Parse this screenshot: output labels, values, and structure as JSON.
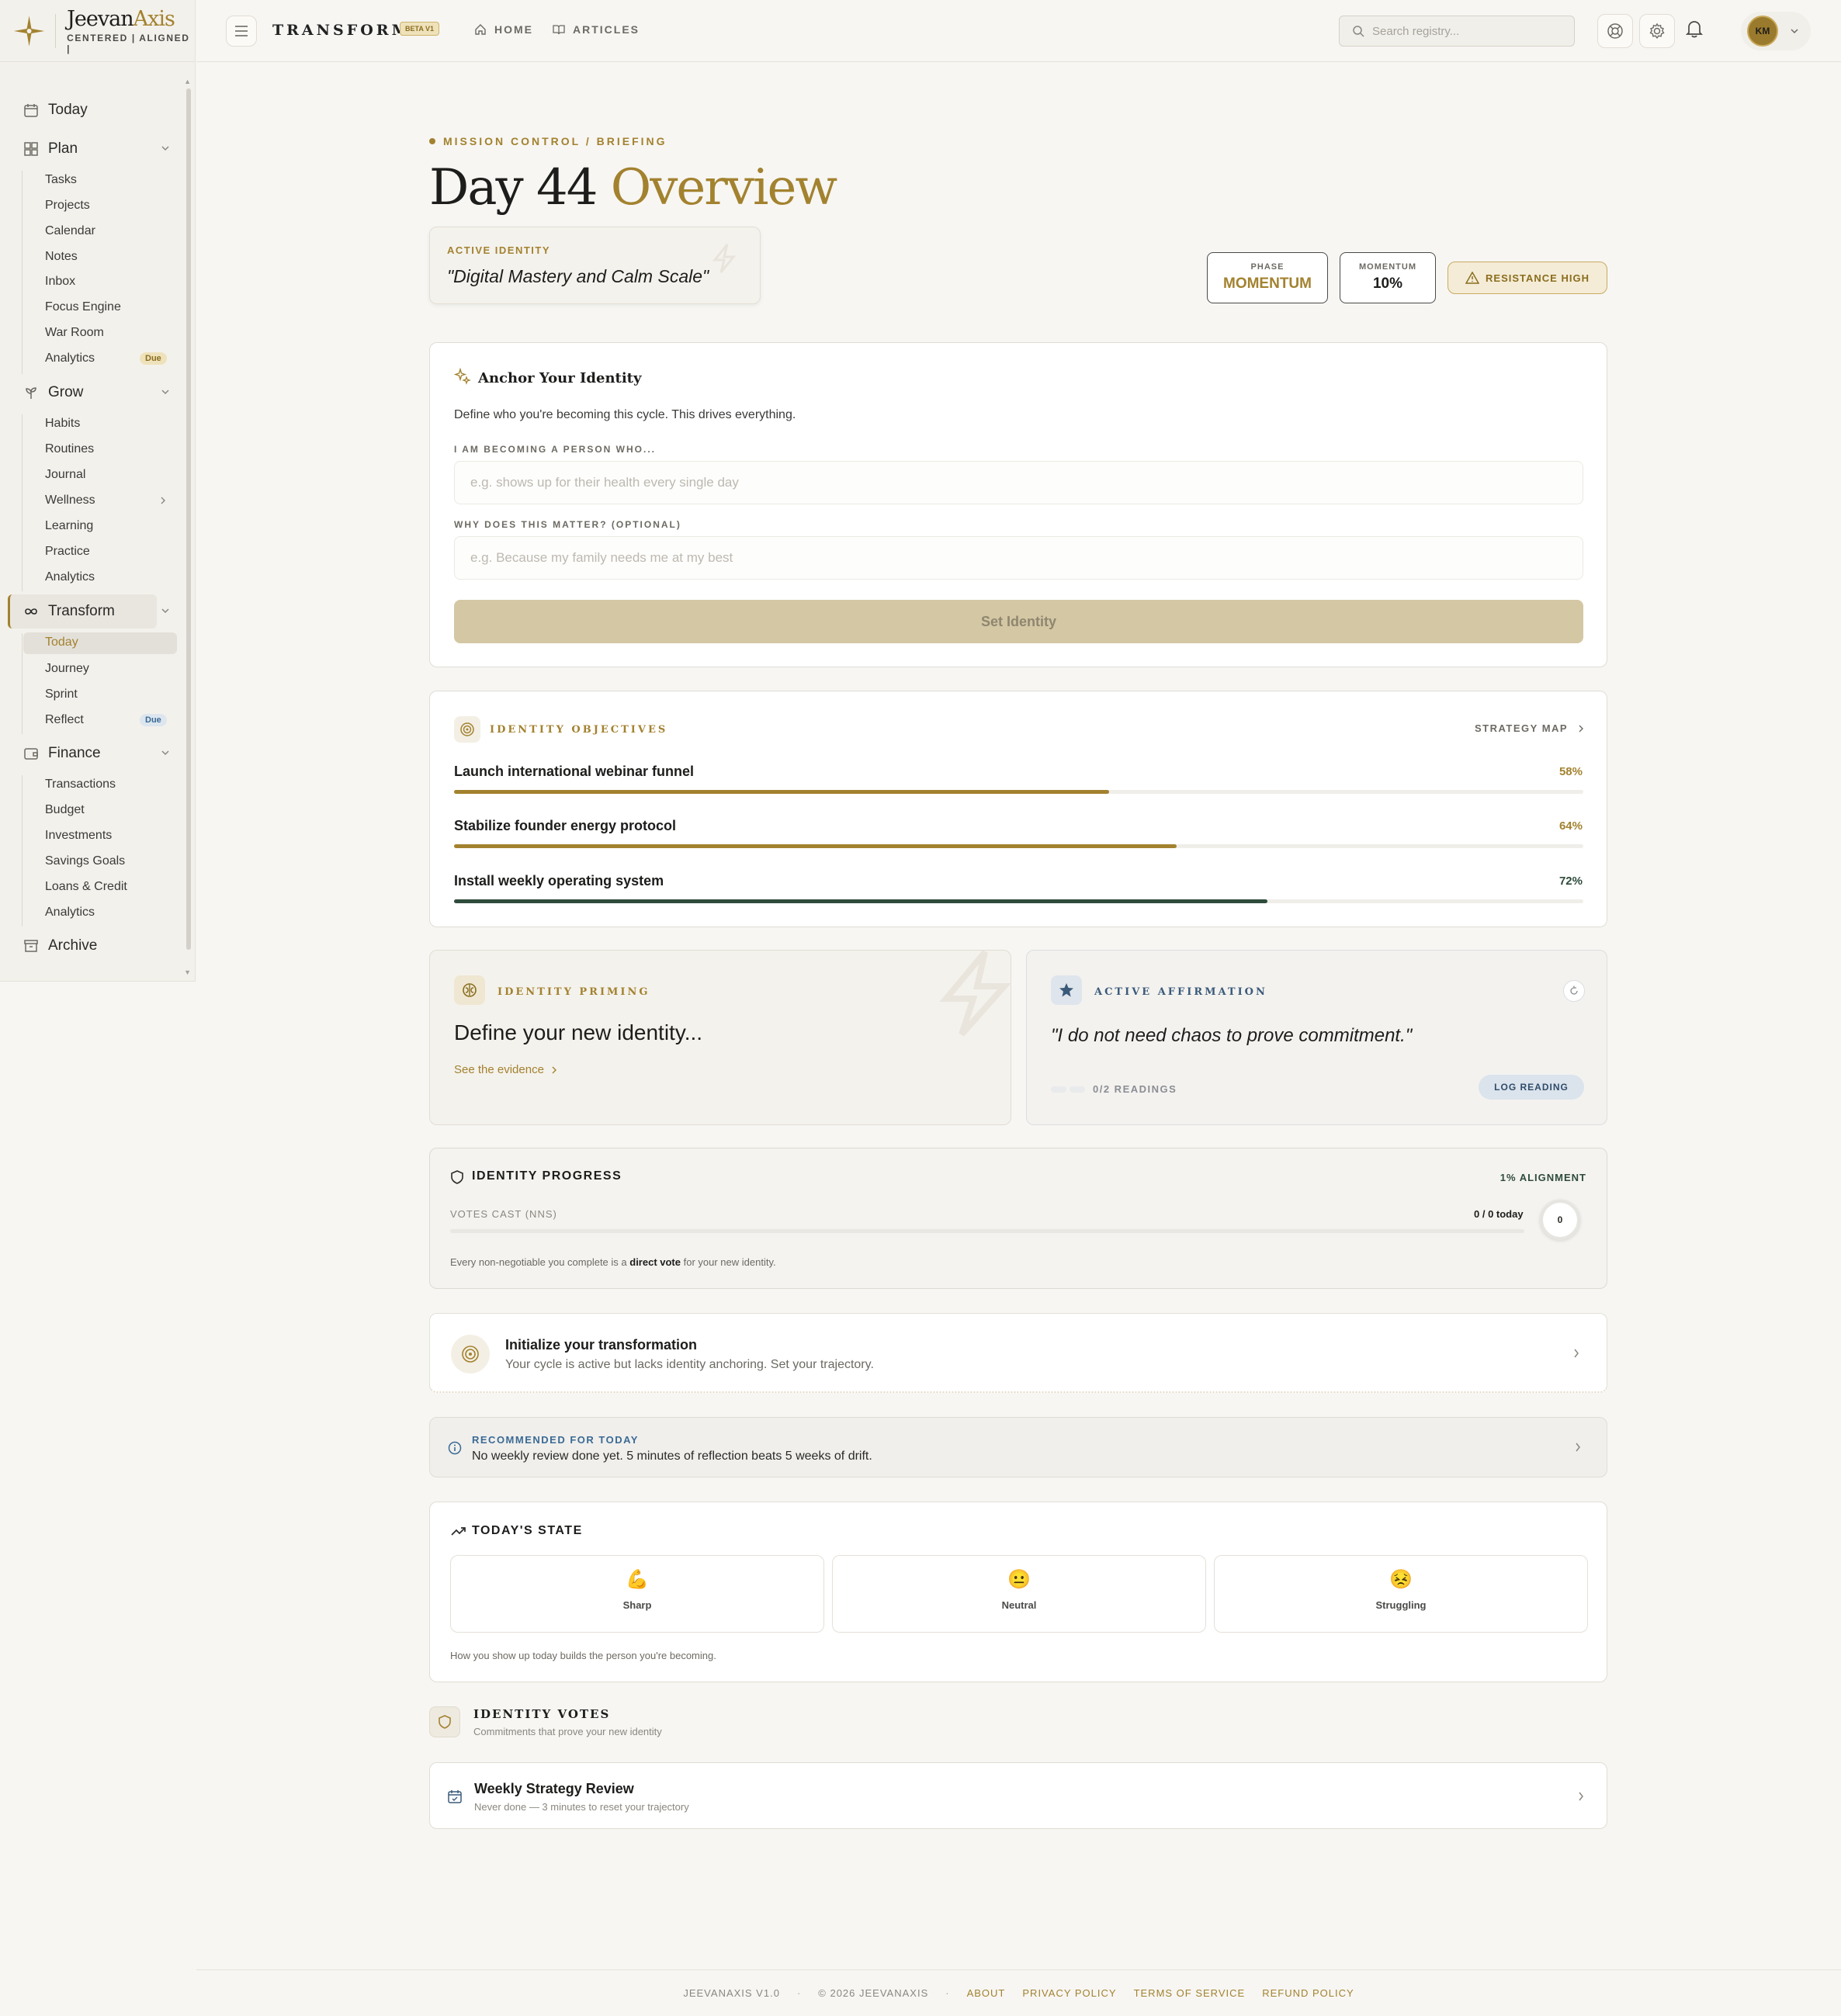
{
  "brand": {
    "name_a": "Jeevan",
    "name_b": "Axis",
    "tagline": "CENTERED | ALIGNED |"
  },
  "sidebar": {
    "today": "Today",
    "plan": {
      "label": "Plan",
      "items": [
        "Tasks",
        "Projects",
        "Calendar",
        "Notes",
        "Inbox",
        "Focus Engine",
        "War Room",
        "Analytics"
      ],
      "badge": "Due"
    },
    "grow": {
      "label": "Grow",
      "items": [
        "Habits",
        "Routines",
        "Journal",
        "Wellness",
        "Learning",
        "Practice",
        "Analytics"
      ]
    },
    "transform": {
      "label": "Transform",
      "items": [
        "Today",
        "Journey",
        "Sprint",
        "Reflect"
      ],
      "badge": "Due"
    },
    "finance": {
      "label": "Finance",
      "items": [
        "Transactions",
        "Budget",
        "Investments",
        "Savings Goals",
        "Loans & Credit",
        "Analytics"
      ]
    },
    "archive": "Archive"
  },
  "header": {
    "title": "TRANSFORM",
    "beta": "BETA V1",
    "nav": [
      "HOME",
      "ARTICLES"
    ],
    "search_placeholder": "Search registry...",
    "avatar": "KM"
  },
  "overview": {
    "breadcrumb": "MISSION CONTROL / BRIEFING",
    "title_a": "Day 44",
    "title_b": "Overview",
    "identity_label": "ACTIVE IDENTITY",
    "identity_value": "\"Digital Mastery and Calm Scale\"",
    "phase_label": "PHASE",
    "phase_value": "MOMENTUM",
    "momentum_label": "MOMENTUM",
    "momentum_value": "10%",
    "resistance": "RESISTANCE HIGH"
  },
  "anchor": {
    "title": "Anchor Your Identity",
    "desc": "Define who you're becoming this cycle. This drives everything.",
    "field1_label": "I AM BECOMING A PERSON WHO...",
    "field1_placeholder": "e.g. shows up for their health every single day",
    "field2_label": "WHY DOES THIS MATTER? (OPTIONAL)",
    "field2_placeholder": "e.g. Because my family needs me at my best",
    "button": "Set Identity"
  },
  "objectives": {
    "title": "IDENTITY OBJECTIVES",
    "link": "STRATEGY MAP",
    "items": [
      {
        "name": "Launch international webinar funnel",
        "pct_label": "58%",
        "pct": 58,
        "color": "#a3822f"
      },
      {
        "name": "Stabilize founder energy protocol",
        "pct_label": "64%",
        "pct": 64,
        "color": "#a3822f"
      },
      {
        "name": "Install weekly operating system",
        "pct_label": "72%",
        "pct": 72,
        "color": "#2f4b3c"
      }
    ]
  },
  "priming": {
    "title": "IDENTITY PRIMING",
    "headline": "Define your new identity...",
    "link": "See the evidence"
  },
  "affirmation": {
    "title": "ACTIVE AFFIRMATION",
    "quote": "\"I do not need chaos to prove commitment.\"",
    "readings": "0/2 READINGS",
    "button": "LOG READING"
  },
  "progress": {
    "title": "IDENTITY PROGRESS",
    "alignment": "1% ALIGNMENT",
    "votes_label": "VOTES CAST (NNS)",
    "votes_count": "0 / 0 today",
    "ring": "0",
    "note_a": "Every non-negotiable you complete is a ",
    "note_b": "direct vote",
    "note_c": " for your new identity."
  },
  "initialize": {
    "title": "Initialize your transformation",
    "desc": "Your cycle is active but lacks identity anchoring. Set your trajectory."
  },
  "recommended": {
    "label": "RECOMMENDED FOR TODAY",
    "text": "No weekly review done yet. 5 minutes of reflection beats 5 weeks of drift."
  },
  "state": {
    "title": "TODAY'S STATE",
    "options": [
      {
        "emoji": "💪",
        "label": "Sharp"
      },
      {
        "emoji": "😐",
        "label": "Neutral"
      },
      {
        "emoji": "😣",
        "label": "Struggling"
      }
    ],
    "note": "How you show up today builds the person you're becoming."
  },
  "votes": {
    "title": "IDENTITY VOTES",
    "subtitle": "Commitments that prove your new identity"
  },
  "weekly": {
    "title": "Weekly Strategy Review",
    "desc": "Never done — 3 minutes to reset your trajectory"
  },
  "footer": [
    "JEEVANAXIS V1.0",
    "·",
    "© 2026 JEEVANAXIS",
    "·",
    "ABOUT",
    "PRIVACY POLICY",
    "TERMS OF SERVICE",
    "REFUND POLICY"
  ],
  "colors": {
    "gold": "#a3822f",
    "green": "#2f4b3c",
    "blue": "#3b5a7a",
    "bg": "#f7f6f3"
  }
}
